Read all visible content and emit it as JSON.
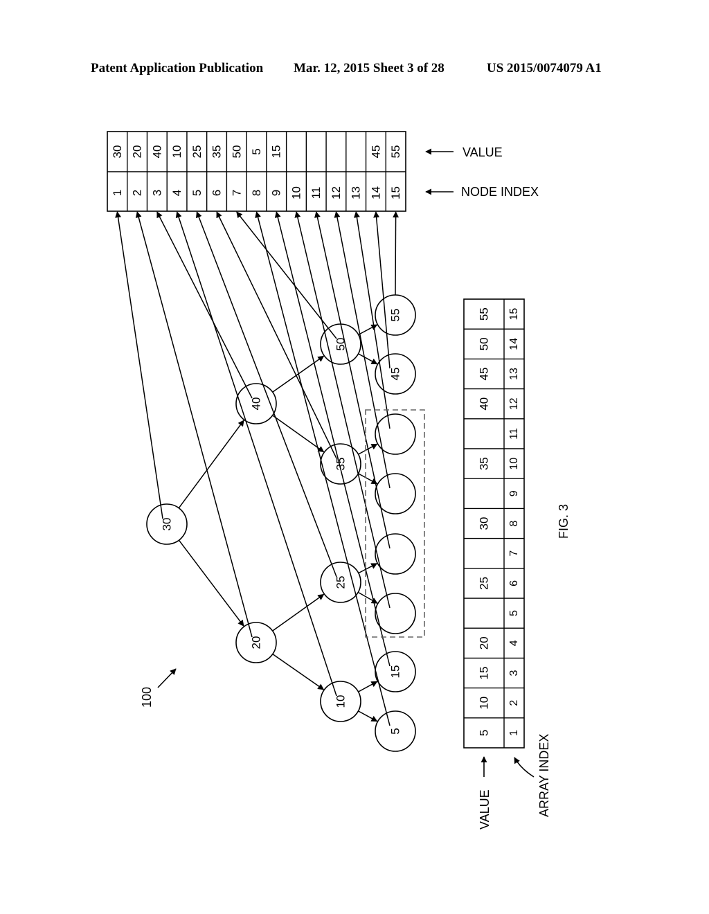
{
  "header": {
    "publication": "Patent Application Publication",
    "date_sheet": "Mar. 12, 2015  Sheet 3 of 28",
    "number": "US 2015/0074079 A1"
  },
  "figure": {
    "label": "FIG. 3",
    "reference_numeral": "100"
  },
  "tree": {
    "nodes": [
      {
        "index": 1,
        "value": "30"
      },
      {
        "index": 2,
        "value": "20"
      },
      {
        "index": 3,
        "value": "40"
      },
      {
        "index": 4,
        "value": "10"
      },
      {
        "index": 5,
        "value": "25"
      },
      {
        "index": 6,
        "value": "35"
      },
      {
        "index": 7,
        "value": "50"
      },
      {
        "index": 8,
        "value": "5"
      },
      {
        "index": 9,
        "value": "15"
      },
      {
        "index": 10,
        "value": ""
      },
      {
        "index": 11,
        "value": ""
      },
      {
        "index": 12,
        "value": ""
      },
      {
        "index": 13,
        "value": ""
      },
      {
        "index": 14,
        "value": "45"
      },
      {
        "index": 15,
        "value": "55"
      }
    ],
    "empty_leaves_group": "dashed box around nodes 10-13"
  },
  "node_table": {
    "value_label": "VALUE",
    "index_label": "NODE INDEX",
    "values": [
      "30",
      "20",
      "40",
      "10",
      "25",
      "35",
      "50",
      "5",
      "15",
      "",
      "",
      "",
      "",
      "45",
      "55"
    ],
    "indices": [
      "1",
      "2",
      "3",
      "4",
      "5",
      "6",
      "7",
      "8",
      "9",
      "10",
      "11",
      "12",
      "13",
      "14",
      "15"
    ]
  },
  "array_table": {
    "value_label": "VALUE",
    "index_label": "ARRAY INDEX",
    "values": [
      "5",
      "10",
      "15",
      "20",
      "",
      "25",
      "",
      "30",
      "",
      "35",
      "",
      "40",
      "45",
      "50",
      "55"
    ],
    "indices": [
      "1",
      "2",
      "3",
      "4",
      "5",
      "6",
      "7",
      "8",
      "9",
      "10",
      "11",
      "12",
      "13",
      "14",
      "15"
    ]
  }
}
